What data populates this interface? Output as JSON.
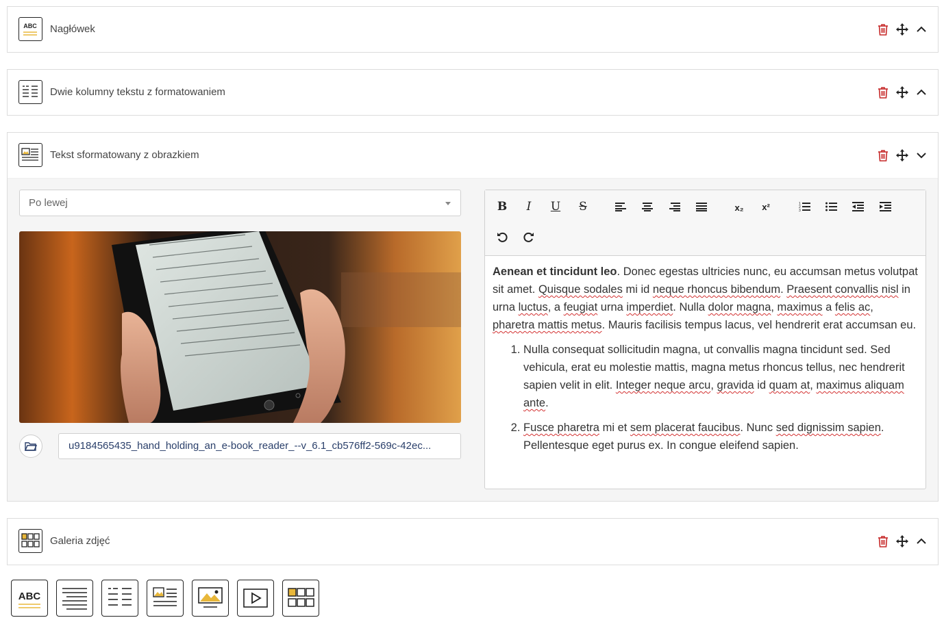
{
  "blocks": [
    {
      "title": "Nagłówek",
      "icon": "heading-icon",
      "expanded": false
    },
    {
      "title": "Dwie kolumny tekstu z formatowaniem",
      "icon": "two-columns-icon",
      "expanded": false
    },
    {
      "title": "Tekst sformatowany z obrazkiem",
      "icon": "text-image-icon",
      "expanded": true
    },
    {
      "title": "Galeria zdjęć",
      "icon": "gallery-icon",
      "expanded": false
    }
  ],
  "abc_label": "ABC",
  "image_block": {
    "position_select": {
      "value": "Po lewej"
    },
    "image_alt": "hand holding an e-book reader",
    "file_name": "u9184565435_hand_holding_an_e-book_reader_--v_6.1_cb576ff2-569c-42ec...",
    "editor": {
      "toolbar": {
        "bold": "B",
        "italic": "I",
        "underline": "U",
        "strikethrough": "S",
        "subscript": "x₂",
        "superscript": "x²"
      },
      "paragraph": {
        "bold_lead": "Aenean et tincidunt leo",
        "t1": ". Donec egestas ultricies nunc, eu accumsan metus volutpat sit amet. ",
        "s1": "Quisque sodales",
        "t2": " mi id ",
        "s2": "neque rhoncus bibendum",
        "t3": ". ",
        "s3": "Praesent convallis nisl",
        "t4": " in urna ",
        "s4": "luctus",
        "t5": ", a ",
        "s5": "feugiat",
        "t6": " urna ",
        "s6": "imperdiet",
        "t7": ". Nulla ",
        "s7": "dolor magna",
        "t8": ", ",
        "s8": "maximus",
        "t9": " a ",
        "s9": "felis ac",
        "t10": ", ",
        "s10": "pharetra mattis metus",
        "t11": ". Mauris facilisis tempus lacus, vel hendrerit erat accumsan eu."
      },
      "list": [
        {
          "t1": "Nulla consequat sollicitudin magna, ut convallis magna tincidunt sed. Sed vehicula, erat eu molestie mattis, magna metus rhoncus tellus, nec hendrerit sapien velit in elit. ",
          "s1": "Integer neque arcu",
          "t2": ", ",
          "s2": "gravida",
          "t3": " id ",
          "s3": "quam at",
          "t4": ", ",
          "s4": "maximus aliquam ante",
          "t5": "."
        },
        {
          "s1": "Fusce pharetra",
          "t1": " mi et ",
          "s2": "sem placerat faucibus",
          "t2": ". Nunc ",
          "s3": "sed dignissim sapien",
          "t3": ". Pellentesque eget purus ex. In congue eleifend sapien."
        }
      ]
    }
  },
  "add_buttons": [
    {
      "name": "add-heading-button",
      "icon": "heading-icon"
    },
    {
      "name": "add-text-button",
      "icon": "text-lines-icon"
    },
    {
      "name": "add-two-columns-button",
      "icon": "two-columns-icon"
    },
    {
      "name": "add-text-image-button",
      "icon": "text-image-icon"
    },
    {
      "name": "add-image-button",
      "icon": "image-icon"
    },
    {
      "name": "add-video-button",
      "icon": "video-icon"
    },
    {
      "name": "add-gallery-button",
      "icon": "gallery-icon"
    }
  ],
  "colors": {
    "accent": "#e8b73a",
    "delete": "#c62828",
    "border": "#dcdcdc",
    "panel": "#f5f5f5"
  }
}
